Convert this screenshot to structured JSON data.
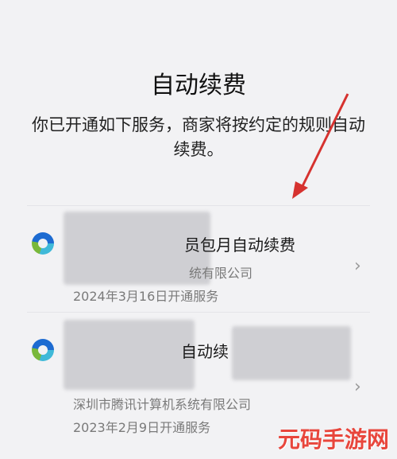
{
  "header": {
    "title": "自动续费",
    "description": "你已开通如下服务，商家将按约定的规则自动续费。"
  },
  "subscriptions": [
    {
      "title": "员包月自动续费",
      "company": "统有限公司",
      "date": "2024年3月16日开通服务",
      "icon": "tencent-app-icon"
    },
    {
      "title": "自动续",
      "company": "深圳市腾讯计算机系统有限公司",
      "date": "2023年2月9日开通服务",
      "icon": "tencent-app-icon"
    }
  ],
  "annotation": {
    "arrow_color": "#d6322f"
  },
  "watermark": {
    "text": "元码手游网"
  }
}
